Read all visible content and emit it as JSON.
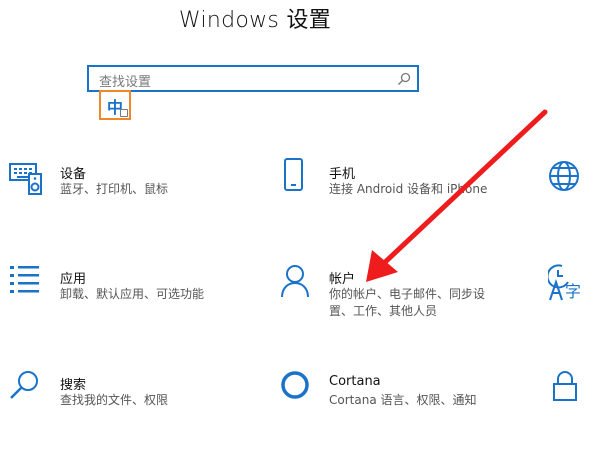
{
  "window": {
    "title": "Windows 设置"
  },
  "search": {
    "placeholder": "查找设置",
    "icon": "search-icon"
  },
  "ime": {
    "label": "中"
  },
  "tiles": [
    {
      "id": "devices",
      "icon": "keyboard-speaker-icon",
      "title": "设备",
      "desc": [
        "蓝牙、打印机、鼠标"
      ]
    },
    {
      "id": "phone",
      "icon": "phone-icon",
      "title": "手机",
      "desc": [
        "连接 Android 设备和 iPhone"
      ]
    },
    {
      "id": "network",
      "icon": "globe-icon",
      "title": "",
      "desc": []
    },
    {
      "id": "apps",
      "icon": "apps-list-icon",
      "title": "应用",
      "desc": [
        "卸载、默认应用、可选功能"
      ]
    },
    {
      "id": "accounts",
      "icon": "person-icon",
      "title": "帐户",
      "desc": [
        "你的帐户、电子邮件、同步设",
        "置、工作、其他人员"
      ]
    },
    {
      "id": "time-language",
      "icon": "time-language-icon",
      "title": "",
      "desc": []
    },
    {
      "id": "search-tile",
      "icon": "magnifier-icon",
      "title": "搜索",
      "desc": [
        "查找我的文件、权限"
      ]
    },
    {
      "id": "cortana",
      "icon": "cortana-ring-icon",
      "title": "Cortana",
      "desc": [
        "Cortana 语言、权限、通知"
      ]
    },
    {
      "id": "privacy",
      "icon": "lock-icon",
      "title": "",
      "desc": []
    }
  ],
  "colors": {
    "accent": "#1a73c9",
    "ime_border": "#f0882a",
    "arrow": "#ee1c1c"
  }
}
